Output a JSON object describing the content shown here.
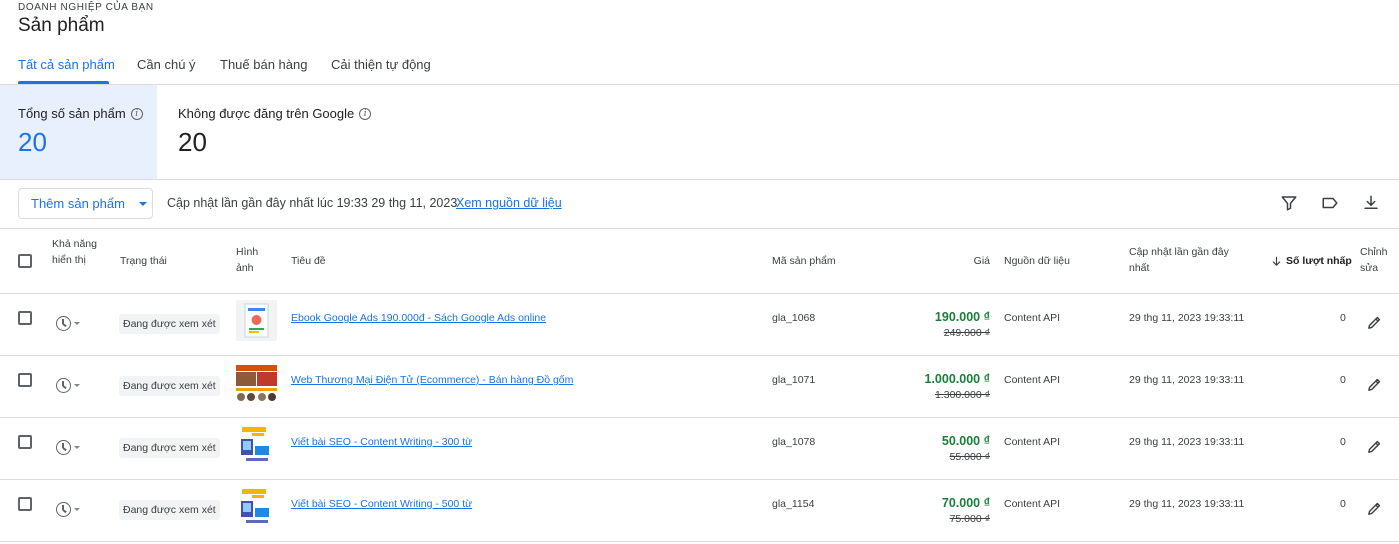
{
  "header": {
    "overline": "DOANH NGHIỆP CỦA BẠN",
    "title": "Sản phẩm"
  },
  "tabs": [
    {
      "label": "Tất cả sản phẩm",
      "active": true
    },
    {
      "label": "Cần chú ý",
      "active": false
    },
    {
      "label": "Thuế bán hàng",
      "active": false
    },
    {
      "label": "Cải thiện tự động",
      "active": false
    }
  ],
  "summary": {
    "total_label": "Tổng số sản phẩm",
    "total_value": "20",
    "not_listed_label": "Không được đăng trên Google",
    "not_listed_value": "20"
  },
  "toolbar": {
    "add_button": "Thêm sản phẩm",
    "updated_text": "Cập nhật lần gần đây nhất lúc 19:33 29 thg 11, 2023",
    "source_link": "Xem nguồn dữ liệu",
    "icons": [
      "filter-icon",
      "label-icon",
      "download-icon"
    ]
  },
  "table": {
    "columns": {
      "visibility": "Khả năng hiển thị",
      "status": "Trạng thái",
      "image": "Hình ảnh",
      "title": "Tiêu đề",
      "id": "Mã sản phẩm",
      "price": "Giá",
      "source": "Nguồn dữ liệu",
      "updated": "Cập nhật lần gần đây nhất",
      "clicks": "Số lượt nhấp",
      "edit": "Chỉnh sửa"
    },
    "rows": [
      {
        "status": "Đang được xem xét",
        "title": "Ebook Google Ads 190.000đ - Sách Google Ads online",
        "id": "gla_1068",
        "price": "190.000 ₫",
        "old_price": "249.000 ₫",
        "source": "Content API",
        "updated": "29 thg 11, 2023 19:33:11",
        "clicks": "0"
      },
      {
        "status": "Đang được xem xét",
        "title": "Web Thương Mại Điện Tử (Ecommerce) - Bán hàng Đồ gốm",
        "id": "gla_1071",
        "price": "1.000.000 ₫",
        "old_price": "1.300.000 ₫",
        "source": "Content API",
        "updated": "29 thg 11, 2023 19:33:11",
        "clicks": "0"
      },
      {
        "status": "Đang được xem xét",
        "title": "Viết bài SEO - Content Writing - 300 từ",
        "id": "gla_1078",
        "price": "50.000 ₫",
        "old_price": "55.000 ₫",
        "source": "Content API",
        "updated": "29 thg 11, 2023 19:33:11",
        "clicks": "0"
      },
      {
        "status": "Đang được xem xét",
        "title": "Viết bài SEO - Content Writing - 500 từ",
        "id": "gla_1154",
        "price": "70.000 ₫",
        "old_price": "75.000 ₫",
        "source": "Content API",
        "updated": "29 thg 11, 2023 19:33:11",
        "clicks": "0"
      }
    ]
  },
  "colors": {
    "accent": "#1a73e8",
    "selected_card_bg": "#e8f0fe",
    "price_green": "#188038",
    "divider": "#dadce0"
  }
}
